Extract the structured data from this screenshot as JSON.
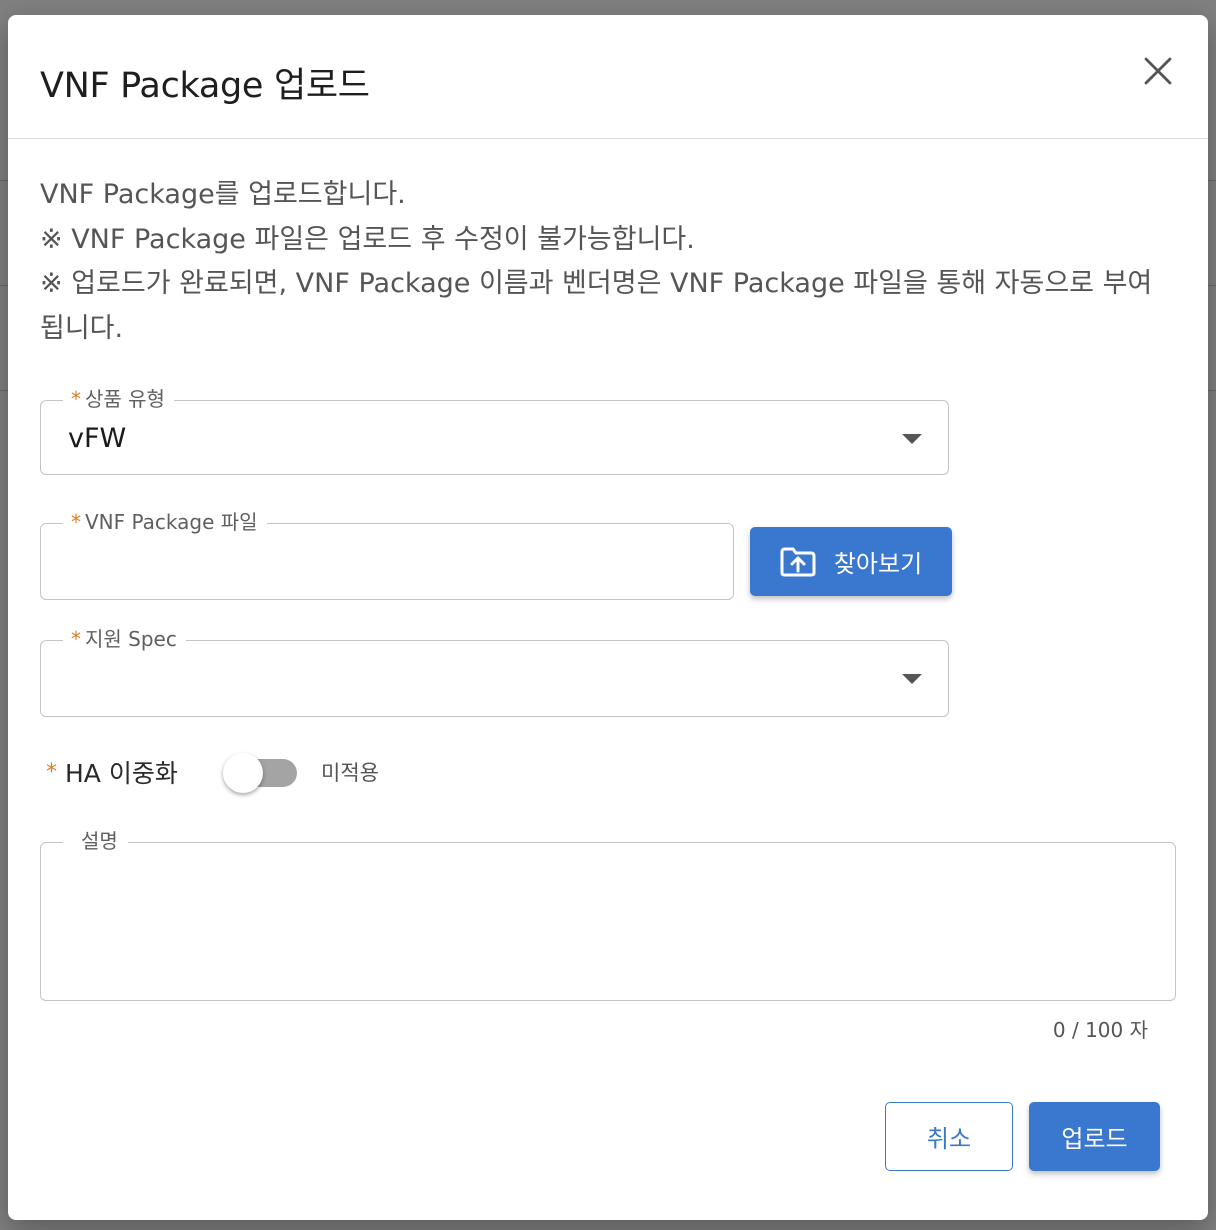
{
  "dialog": {
    "title": "VNF Package 업로드",
    "close_icon": "close-icon",
    "intro": {
      "line1": "VNF Package를 업로드합니다.",
      "line2": "※ VNF Package 파일은 업로드 후 수정이 불가능합니다.",
      "line3": "※ 업로드가 완료되면, VNF Package 이름과 벤더명은 VNF Package 파일을 통해 자동으로 부여",
      "line4": "됩니다."
    }
  },
  "form": {
    "required_mark": "*",
    "product_type": {
      "label": "상품 유형",
      "value": "vFW"
    },
    "package_file": {
      "label": "VNF Package 파일",
      "value": "",
      "browse_label": "찾아보기",
      "browse_icon": "folder-upload-icon"
    },
    "support_spec": {
      "label": "지원 Spec",
      "value": ""
    },
    "ha": {
      "label": "HA 이중화",
      "state_label": "미적용",
      "enabled": false
    },
    "description": {
      "label": "설명",
      "value": "",
      "counter": "0 / 100 자"
    }
  },
  "footer": {
    "cancel_label": "취소",
    "upload_label": "업로드"
  },
  "colors": {
    "primary": "#3a78d0",
    "required": "#e07b24",
    "toggle_off": "#a4a4a4"
  }
}
